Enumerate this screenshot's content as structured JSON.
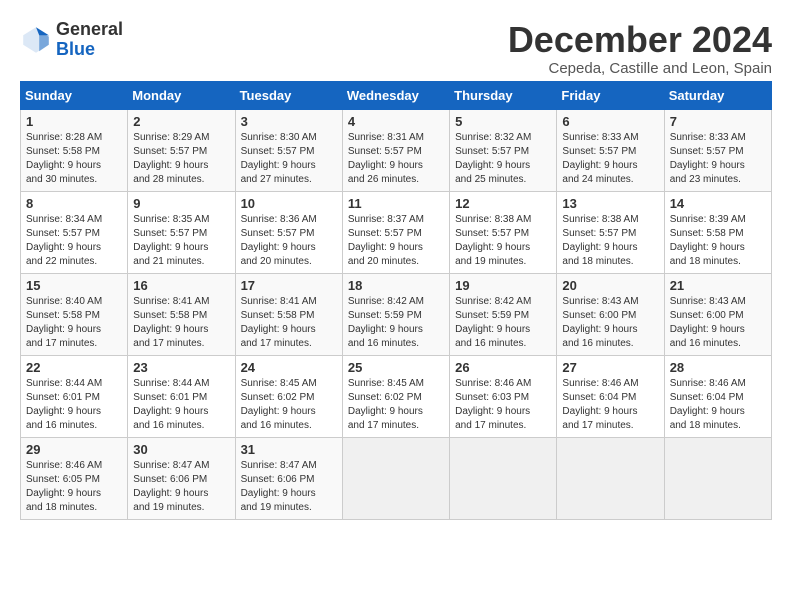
{
  "header": {
    "logo_line1": "General",
    "logo_line2": "Blue",
    "title": "December 2024",
    "subtitle": "Cepeda, Castille and Leon, Spain"
  },
  "weekdays": [
    "Sunday",
    "Monday",
    "Tuesday",
    "Wednesday",
    "Thursday",
    "Friday",
    "Saturday"
  ],
  "weeks": [
    [
      {
        "day": "1",
        "info": "Sunrise: 8:28 AM\nSunset: 5:58 PM\nDaylight: 9 hours\nand 30 minutes."
      },
      {
        "day": "2",
        "info": "Sunrise: 8:29 AM\nSunset: 5:57 PM\nDaylight: 9 hours\nand 28 minutes."
      },
      {
        "day": "3",
        "info": "Sunrise: 8:30 AM\nSunset: 5:57 PM\nDaylight: 9 hours\nand 27 minutes."
      },
      {
        "day": "4",
        "info": "Sunrise: 8:31 AM\nSunset: 5:57 PM\nDaylight: 9 hours\nand 26 minutes."
      },
      {
        "day": "5",
        "info": "Sunrise: 8:32 AM\nSunset: 5:57 PM\nDaylight: 9 hours\nand 25 minutes."
      },
      {
        "day": "6",
        "info": "Sunrise: 8:33 AM\nSunset: 5:57 PM\nDaylight: 9 hours\nand 24 minutes."
      },
      {
        "day": "7",
        "info": "Sunrise: 8:33 AM\nSunset: 5:57 PM\nDaylight: 9 hours\nand 23 minutes."
      }
    ],
    [
      {
        "day": "8",
        "info": "Sunrise: 8:34 AM\nSunset: 5:57 PM\nDaylight: 9 hours\nand 22 minutes."
      },
      {
        "day": "9",
        "info": "Sunrise: 8:35 AM\nSunset: 5:57 PM\nDaylight: 9 hours\nand 21 minutes."
      },
      {
        "day": "10",
        "info": "Sunrise: 8:36 AM\nSunset: 5:57 PM\nDaylight: 9 hours\nand 20 minutes."
      },
      {
        "day": "11",
        "info": "Sunrise: 8:37 AM\nSunset: 5:57 PM\nDaylight: 9 hours\nand 20 minutes."
      },
      {
        "day": "12",
        "info": "Sunrise: 8:38 AM\nSunset: 5:57 PM\nDaylight: 9 hours\nand 19 minutes."
      },
      {
        "day": "13",
        "info": "Sunrise: 8:38 AM\nSunset: 5:57 PM\nDaylight: 9 hours\nand 18 minutes."
      },
      {
        "day": "14",
        "info": "Sunrise: 8:39 AM\nSunset: 5:58 PM\nDaylight: 9 hours\nand 18 minutes."
      }
    ],
    [
      {
        "day": "15",
        "info": "Sunrise: 8:40 AM\nSunset: 5:58 PM\nDaylight: 9 hours\nand 17 minutes."
      },
      {
        "day": "16",
        "info": "Sunrise: 8:41 AM\nSunset: 5:58 PM\nDaylight: 9 hours\nand 17 minutes."
      },
      {
        "day": "17",
        "info": "Sunrise: 8:41 AM\nSunset: 5:58 PM\nDaylight: 9 hours\nand 17 minutes."
      },
      {
        "day": "18",
        "info": "Sunrise: 8:42 AM\nSunset: 5:59 PM\nDaylight: 9 hours\nand 16 minutes."
      },
      {
        "day": "19",
        "info": "Sunrise: 8:42 AM\nSunset: 5:59 PM\nDaylight: 9 hours\nand 16 minutes."
      },
      {
        "day": "20",
        "info": "Sunrise: 8:43 AM\nSunset: 6:00 PM\nDaylight: 9 hours\nand 16 minutes."
      },
      {
        "day": "21",
        "info": "Sunrise: 8:43 AM\nSunset: 6:00 PM\nDaylight: 9 hours\nand 16 minutes."
      }
    ],
    [
      {
        "day": "22",
        "info": "Sunrise: 8:44 AM\nSunset: 6:01 PM\nDaylight: 9 hours\nand 16 minutes."
      },
      {
        "day": "23",
        "info": "Sunrise: 8:44 AM\nSunset: 6:01 PM\nDaylight: 9 hours\nand 16 minutes."
      },
      {
        "day": "24",
        "info": "Sunrise: 8:45 AM\nSunset: 6:02 PM\nDaylight: 9 hours\nand 16 minutes."
      },
      {
        "day": "25",
        "info": "Sunrise: 8:45 AM\nSunset: 6:02 PM\nDaylight: 9 hours\nand 17 minutes."
      },
      {
        "day": "26",
        "info": "Sunrise: 8:46 AM\nSunset: 6:03 PM\nDaylight: 9 hours\nand 17 minutes."
      },
      {
        "day": "27",
        "info": "Sunrise: 8:46 AM\nSunset: 6:04 PM\nDaylight: 9 hours\nand 17 minutes."
      },
      {
        "day": "28",
        "info": "Sunrise: 8:46 AM\nSunset: 6:04 PM\nDaylight: 9 hours\nand 18 minutes."
      }
    ],
    [
      {
        "day": "29",
        "info": "Sunrise: 8:46 AM\nSunset: 6:05 PM\nDaylight: 9 hours\nand 18 minutes."
      },
      {
        "day": "30",
        "info": "Sunrise: 8:47 AM\nSunset: 6:06 PM\nDaylight: 9 hours\nand 19 minutes."
      },
      {
        "day": "31",
        "info": "Sunrise: 8:47 AM\nSunset: 6:06 PM\nDaylight: 9 hours\nand 19 minutes."
      },
      {
        "day": "",
        "info": ""
      },
      {
        "day": "",
        "info": ""
      },
      {
        "day": "",
        "info": ""
      },
      {
        "day": "",
        "info": ""
      }
    ]
  ]
}
